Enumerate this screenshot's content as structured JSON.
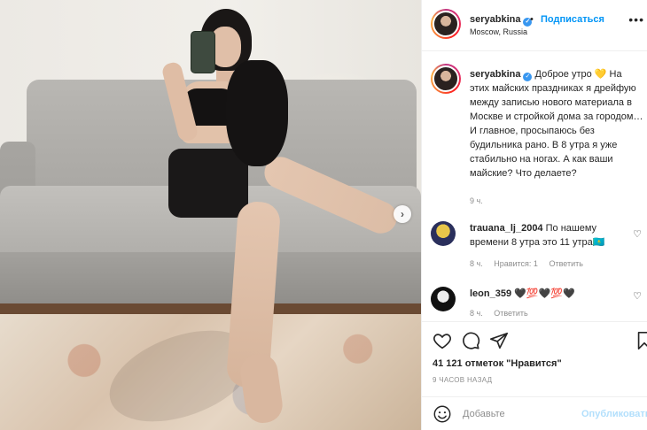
{
  "header": {
    "username": "seryabkina",
    "follow_label": "Подписаться",
    "location": "Moscow, Russia",
    "more_label": "•••"
  },
  "caption": {
    "username": "seryabkina",
    "text": "Доброе утро 💛 На этих майских праздниках я дрейфую между записью нового материала в Москве и стройкой дома за городом… И главное, просыпаюсь без будильника рано. В 8 утра я уже стабильно на ногах. А как ваши майские? Что делаете?",
    "time": "9 ч."
  },
  "comments": [
    {
      "username": "trauana_lj_2004",
      "text": "По нашему времени 8 утра это 11 утра🇰🇿",
      "time": "8 ч.",
      "likes": "Нравится: 1",
      "reply": "Ответить"
    },
    {
      "username": "leon_359",
      "text": "🖤💯🖤💯🖤",
      "time": "8 ч.",
      "reply": "Ответить"
    }
  ],
  "stats": {
    "likes": "41 121 отметок \"Нравится\"",
    "ago": "9 ЧАСОВ НАЗАД"
  },
  "add_comment": {
    "placeholder": "Добавьте",
    "publish": "Опубликовать"
  },
  "icons": {
    "like": "heart-icon",
    "comment": "comment-icon",
    "share": "share-icon",
    "save": "bookmark-icon",
    "emoji": "smiley-icon",
    "next": "chevron-right-icon",
    "verified": "verified-badge-icon"
  }
}
